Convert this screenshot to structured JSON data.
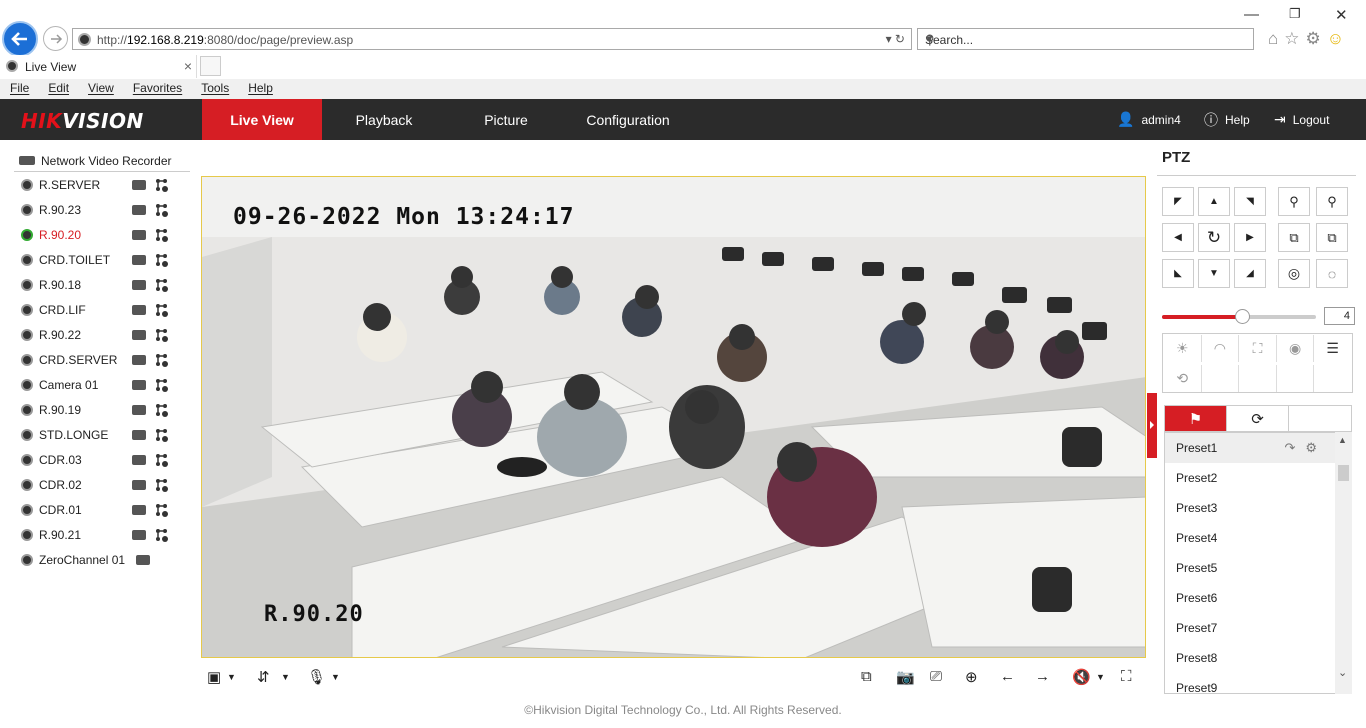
{
  "browser": {
    "url_prefix": "http://",
    "url_host": "192.168.8.219",
    "url_rest": ":8080/doc/page/preview.asp",
    "search_placeholder": "Search...",
    "tab_title": "Live View",
    "menu": [
      "File",
      "Edit",
      "View",
      "Favorites",
      "Tools",
      "Help"
    ]
  },
  "app": {
    "logo_a": "HIK",
    "logo_b": "VISION",
    "nav": [
      "Live View",
      "Playback",
      "Picture",
      "Configuration"
    ],
    "user": "admin4",
    "help": "Help",
    "logout": "Logout"
  },
  "tree": {
    "root": "Network Video Recorder",
    "cameras": [
      {
        "name": "R.SERVER"
      },
      {
        "name": "R.90.23"
      },
      {
        "name": "R.90.20",
        "active": true
      },
      {
        "name": "CRD.TOILET"
      },
      {
        "name": "R.90.18"
      },
      {
        "name": "CRD.LIF"
      },
      {
        "name": "R.90.22"
      },
      {
        "name": "CRD.SERVER"
      },
      {
        "name": "Camera 01"
      },
      {
        "name": "R.90.19"
      },
      {
        "name": "STD.LONGE"
      },
      {
        "name": "CDR.03"
      },
      {
        "name": "CDR.02"
      },
      {
        "name": "CDR.01"
      },
      {
        "name": "R.90.21"
      },
      {
        "name": "ZeroChannel 01"
      }
    ]
  },
  "video": {
    "timestamp": "09-26-2022 Mon 13:24:17",
    "channel_label": "R.90.20"
  },
  "ptz": {
    "title": "PTZ",
    "speed": "4",
    "speed_fraction": 0.52,
    "presets": [
      "Preset1",
      "Preset2",
      "Preset3",
      "Preset4",
      "Preset5",
      "Preset6",
      "Preset7",
      "Preset8",
      "Preset9"
    ]
  },
  "footer": "©Hikvision Digital Technology Co., Ltd. All Rights Reserved.",
  "colors": {
    "accent": "#d61e24",
    "header_bg": "#2b2b2b",
    "video_border": "#e6c94a"
  }
}
